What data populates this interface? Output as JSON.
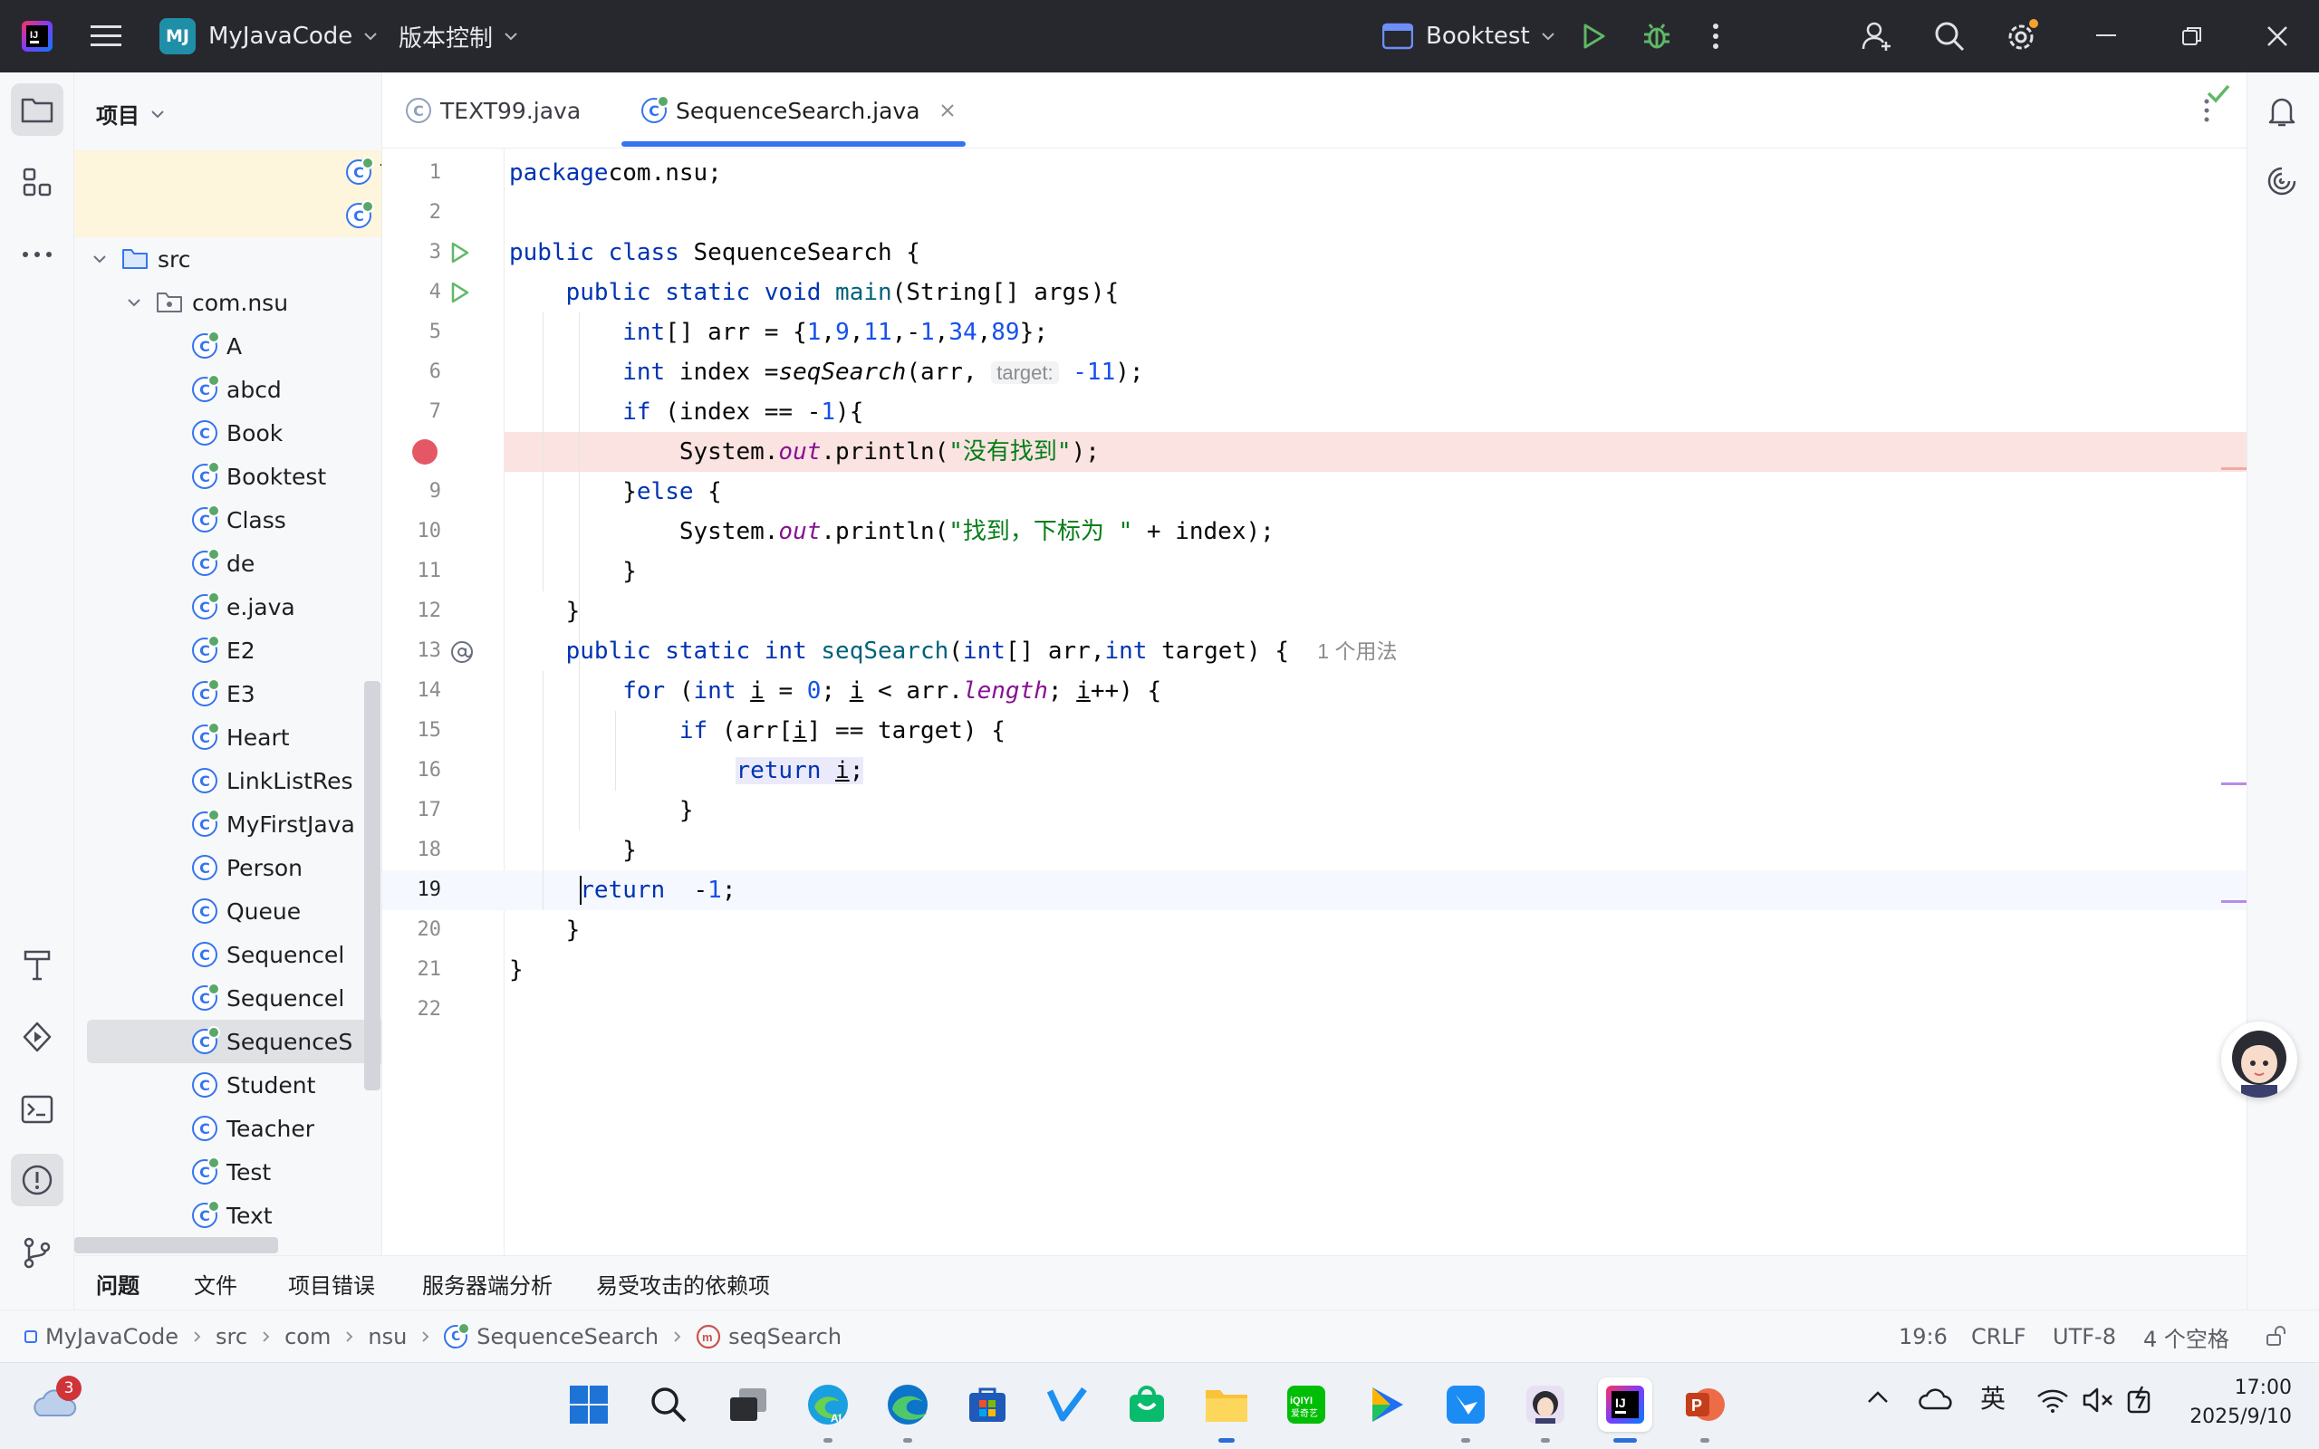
{
  "titlebar": {
    "project_badge": "MJ",
    "project_name": "MyJavaCode",
    "vcs_label": "版本控制",
    "run_config": "Booktest",
    "icons": [
      "app-logo-icon",
      "hamburger-menu-icon",
      "run-icon",
      "debug-icon",
      "more-vertical-icon",
      "add-user-icon",
      "search-icon",
      "settings-icon",
      "minimize-icon",
      "restore-icon",
      "close-icon"
    ]
  },
  "project_panel": {
    "title": "项目",
    "tree": [
      {
        "label": "T",
        "type": "class-run",
        "indent": 7
      },
      {
        "label": "x",
        "type": "class-run",
        "indent": 7
      },
      {
        "label": "src",
        "type": "folder",
        "indent": 1,
        "expanded": true
      },
      {
        "label": "com.nsu",
        "type": "package",
        "indent": 2,
        "expanded": true
      },
      {
        "label": "A",
        "type": "class-run",
        "indent": 3
      },
      {
        "label": "abcd",
        "type": "class-run",
        "indent": 3
      },
      {
        "label": "Book",
        "type": "class",
        "indent": 3
      },
      {
        "label": "Booktest",
        "type": "class-run",
        "indent": 3
      },
      {
        "label": "Class",
        "type": "class-run",
        "indent": 3
      },
      {
        "label": "de",
        "type": "class-run",
        "indent": 3
      },
      {
        "label": "e.java",
        "type": "class-run",
        "indent": 3,
        "collapsed": true
      },
      {
        "label": "E2",
        "type": "class-run",
        "indent": 3
      },
      {
        "label": "E3",
        "type": "class-run",
        "indent": 3
      },
      {
        "label": "Heart",
        "type": "class-run",
        "indent": 3
      },
      {
        "label": "LinkListRes",
        "type": "class",
        "indent": 3
      },
      {
        "label": "MyFirstJava",
        "type": "class-run",
        "indent": 3
      },
      {
        "label": "Person",
        "type": "class",
        "indent": 3
      },
      {
        "label": "Queue",
        "type": "class",
        "indent": 3
      },
      {
        "label": "Sequencel",
        "type": "class",
        "indent": 3
      },
      {
        "label": "Sequencel",
        "type": "class-run",
        "indent": 3
      },
      {
        "label": "SequenceS",
        "type": "class-run",
        "indent": 3,
        "selected": true
      },
      {
        "label": "Student",
        "type": "class",
        "indent": 3
      },
      {
        "label": "Teacher",
        "type": "class",
        "indent": 3
      },
      {
        "label": "Test",
        "type": "class-run",
        "indent": 3
      },
      {
        "label": "Text",
        "type": "class-run",
        "indent": 3
      }
    ]
  },
  "tabs": [
    {
      "label": "TEXT99.java",
      "active": false
    },
    {
      "label": "SequenceSearch.java",
      "active": true
    }
  ],
  "editor": {
    "current_line": 19,
    "breakpoint_line": 8,
    "lines": [
      {
        "n": "1",
        "t": [
          [
            "kw",
            "package"
          ],
          [
            "",
            "com.nsu;"
          ]
        ]
      },
      {
        "n": "2",
        "t": []
      },
      {
        "n": "3",
        "t": [
          [
            "kw",
            "public class "
          ],
          [
            "",
            "SequenceSearch {"
          ]
        ]
      },
      {
        "n": "4",
        "t": [
          [
            "",
            "    "
          ],
          [
            "kw",
            "public static void "
          ],
          [
            "fn",
            "main"
          ],
          [
            "",
            "(String[] args){"
          ]
        ]
      },
      {
        "n": "5",
        "t": [
          [
            "",
            "        "
          ],
          [
            "kw",
            "int"
          ],
          [
            "",
            "[] arr = {"
          ],
          [
            "num",
            "1"
          ],
          [
            "",
            ","
          ],
          [
            "num",
            "9"
          ],
          [
            "",
            ","
          ],
          [
            "num",
            "11"
          ],
          [
            "",
            ",-"
          ],
          [
            "num",
            "1"
          ],
          [
            "",
            ","
          ],
          [
            "num",
            "34"
          ],
          [
            "",
            ","
          ],
          [
            "num",
            "89"
          ],
          [
            "",
            "};"
          ]
        ]
      },
      {
        "n": "6",
        "t": [
          [
            "",
            "        "
          ],
          [
            "kw",
            "int "
          ],
          [
            "",
            "index ="
          ],
          [
            "itb",
            "seqSearch"
          ],
          [
            "",
            "(arr, "
          ],
          [
            "hint",
            "target:"
          ],
          [
            "",
            ""
          ],
          [
            "num",
            " -11"
          ],
          [
            "",
            ");"
          ]
        ]
      },
      {
        "n": "7",
        "t": [
          [
            "",
            "        "
          ],
          [
            "kw",
            "if "
          ],
          [
            "",
            "(index == -"
          ],
          [
            "num",
            "1"
          ],
          [
            "",
            "){"
          ]
        ]
      },
      {
        "n": "",
        "t": [
          [
            "",
            "            System."
          ],
          [
            "it",
            "out"
          ],
          [
            "",
            ".println("
          ],
          [
            "str",
            "\"没有找到\""
          ],
          [
            "",
            ");"
          ]
        ]
      },
      {
        "n": "9",
        "t": [
          [
            "",
            "        }"
          ],
          [
            "kw",
            "else "
          ],
          [
            "",
            "{"
          ]
        ]
      },
      {
        "n": "10",
        "t": [
          [
            "",
            "            System."
          ],
          [
            "it",
            "out"
          ],
          [
            "",
            ".println("
          ],
          [
            "str",
            "\"找到，下标为 \""
          ],
          [
            "",
            " + index);"
          ]
        ]
      },
      {
        "n": "11",
        "t": [
          [
            "",
            "        }"
          ]
        ]
      },
      {
        "n": "12",
        "t": [
          [
            "",
            "    }"
          ]
        ]
      },
      {
        "n": "13",
        "t": [
          [
            "",
            "    "
          ],
          [
            "kw",
            "public static int "
          ],
          [
            "fn",
            "seqSearch"
          ],
          [
            "",
            "("
          ],
          [
            "kw",
            "int"
          ],
          [
            "",
            "[] arr,"
          ],
          [
            "kw",
            "int "
          ],
          [
            "",
            "target) {  "
          ],
          [
            "usage",
            "1 个用法"
          ]
        ]
      },
      {
        "n": "14",
        "t": [
          [
            "",
            "        "
          ],
          [
            "kw",
            "for "
          ],
          [
            "",
            "("
          ],
          [
            "kw",
            "int "
          ],
          [
            "u",
            "i"
          ],
          [
            "",
            " = "
          ],
          [
            "num",
            "0"
          ],
          [
            "",
            "; "
          ],
          [
            "u",
            "i"
          ],
          [
            "",
            " < arr."
          ],
          [
            "it",
            "length"
          ],
          [
            "",
            "; "
          ],
          [
            "u",
            "i"
          ],
          [
            "",
            "++) {"
          ]
        ]
      },
      {
        "n": "15",
        "t": [
          [
            "",
            "            "
          ],
          [
            "kw",
            "if "
          ],
          [
            "",
            "(arr["
          ],
          [
            "u",
            "i"
          ],
          [
            "",
            "] == target) {"
          ]
        ]
      },
      {
        "n": "16",
        "t": [
          [
            "",
            "                "
          ],
          [
            "kwh",
            "return "
          ],
          [
            "uh",
            "i"
          ],
          [
            "h",
            ";"
          ]
        ]
      },
      {
        "n": "17",
        "t": [
          [
            "",
            "            }"
          ]
        ]
      },
      {
        "n": "18",
        "t": [
          [
            "",
            "        }"
          ]
        ]
      },
      {
        "n": "19",
        "t": [
          [
            "",
            "     "
          ],
          [
            "kw",
            "return  "
          ],
          [
            "",
            "-"
          ],
          [
            "num",
            "1"
          ],
          [
            "",
            ";"
          ]
        ]
      },
      {
        "n": "20",
        "t": [
          [
            "",
            "    }"
          ]
        ]
      },
      {
        "n": "21",
        "t": [
          [
            "",
            "}"
          ]
        ]
      },
      {
        "n": "22",
        "t": []
      }
    ]
  },
  "bottom_tabs": [
    "问题",
    "文件",
    "项目错误",
    "服务器端分析",
    "易受攻击的依赖项"
  ],
  "statusbar": {
    "breadcrumb": [
      "MyJavaCode",
      "src",
      "com",
      "nsu",
      "SequenceSearch",
      "seqSearch"
    ],
    "position": "19:6",
    "line_sep": "CRLF",
    "encoding": "UTF-8",
    "indent": "4 个空格"
  },
  "taskbar": {
    "weather_badge": "3",
    "ime": "英",
    "time": "17:00",
    "date": "2025/9/10",
    "apps": [
      "start-icon",
      "search-icon",
      "task-view-icon",
      "edge-ai-icon",
      "edge-icon",
      "store-icon",
      "app-v-icon",
      "bag-icon",
      "folder-icon",
      "iqiyi-icon",
      "video-player-icon",
      "feishu-icon",
      "avatar-app-icon",
      "intellij-icon",
      "powerpoint-icon"
    ]
  }
}
